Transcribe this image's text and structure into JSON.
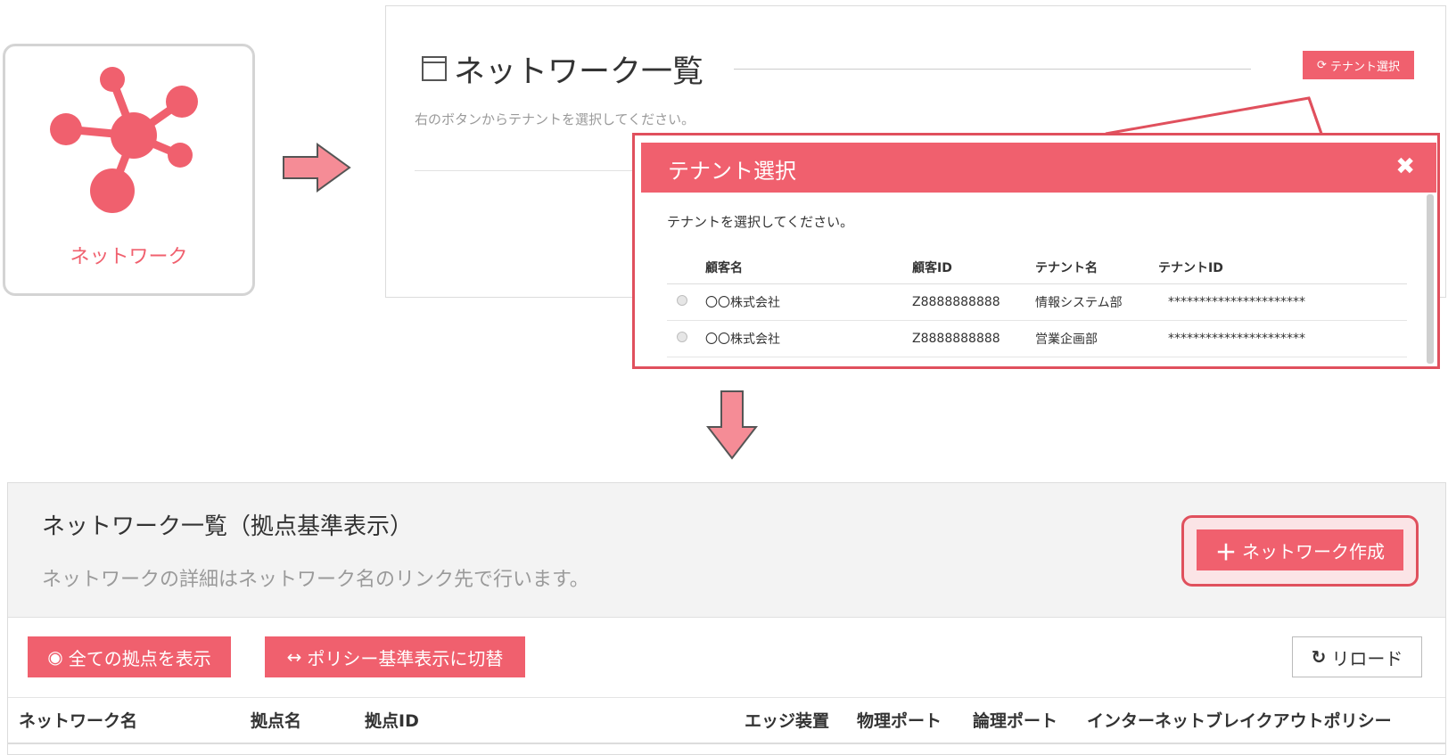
{
  "tile": {
    "label": "ネットワーク",
    "icon": "network-hub-icon"
  },
  "list_panel": {
    "title": "ネットワーク一覧",
    "subtitle": "右のボタンからテナントを選択してください。",
    "tenant_button": "テナント選択"
  },
  "modal": {
    "title": "テナント選択",
    "close": "✖",
    "subtitle": "テナントを選択してください。",
    "columns": [
      "顧客名",
      "顧客ID",
      "テナント名",
      "テナントID"
    ],
    "rows": [
      {
        "customer": "〇〇株式会社",
        "customer_id": "Z8888888888",
        "tenant": "情報システム部",
        "tenant_id": "**********************"
      },
      {
        "customer": "〇〇株式会社",
        "customer_id": "Z8888888888",
        "tenant": "営業企画部",
        "tenant_id": "**********************"
      }
    ]
  },
  "page": {
    "title": "ネットワーク一覧（拠点基準表示）",
    "subtitle": "ネットワークの詳細はネットワーク名のリンク先で行います。",
    "create_button": "ネットワーク作成",
    "show_all_button": "全ての拠点を表示",
    "switch_policy_button": "ポリシー基準表示に切替",
    "reload_button": "リロード",
    "columns": [
      "ネットワーク名",
      "拠点名",
      "拠点ID",
      "エッジ装置",
      "物理ポート",
      "論理ポート",
      "インターネットブレイクアウトポリシー"
    ]
  },
  "colors": {
    "accent": "#f0606e",
    "highlight_border": "#e0505d"
  }
}
